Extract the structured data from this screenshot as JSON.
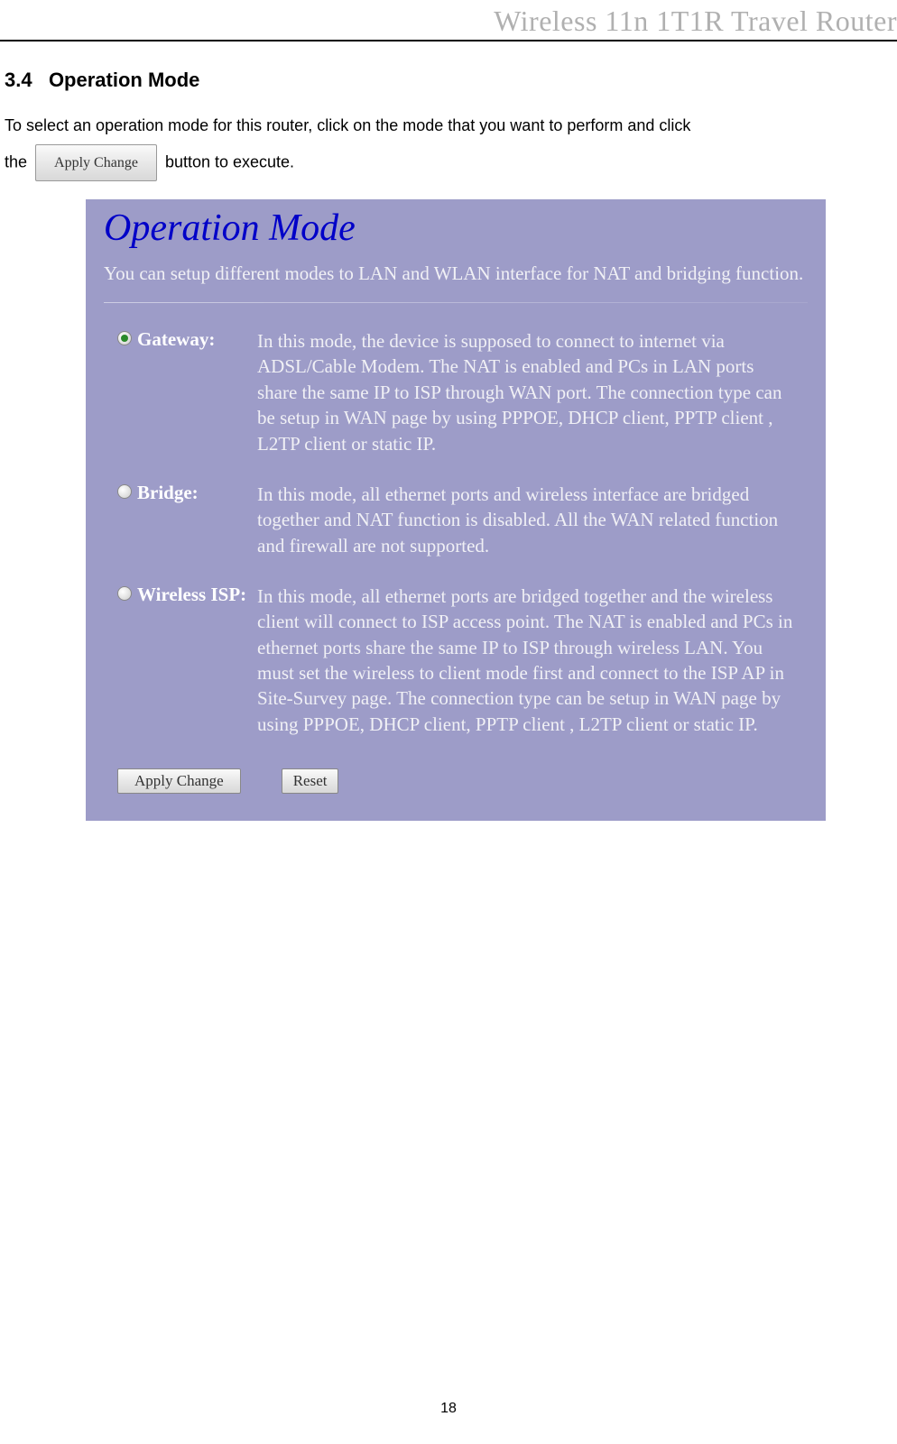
{
  "header": {
    "title": "Wireless 11n 1T1R Travel Router"
  },
  "section": {
    "number": "3.4",
    "title": "Operation Mode"
  },
  "intro": {
    "part1": "To select an operation mode for this router, click on the mode that you want to perform and click",
    "part2_prefix": "the",
    "inline_button": "Apply Change",
    "part2_suffix": "button to execute."
  },
  "panel": {
    "title": "Operation Mode",
    "description": "You can setup different modes to LAN and WLAN interface for NAT and bridging function.",
    "modes": [
      {
        "label": "Gateway:",
        "checked": true,
        "desc": "In this mode, the device is supposed to connect to internet via ADSL/Cable Modem. The NAT is enabled and PCs in LAN ports share the same IP to ISP through WAN port. The connection type can be setup in WAN page by using PPPOE, DHCP client, PPTP client , L2TP client or static IP."
      },
      {
        "label": "Bridge:",
        "checked": false,
        "desc": "In this mode, all ethernet ports and wireless interface are bridged together and NAT function is disabled. All the WAN related function and firewall are not supported."
      },
      {
        "label": "Wireless ISP:",
        "checked": false,
        "desc": "In this mode, all ethernet ports are bridged together and the wireless client will connect to ISP access point. The NAT is enabled and PCs in ethernet ports share the same IP to ISP through wireless LAN. You must set the wireless to client mode first and connect to the ISP AP in Site-Survey page. The connection type can be setup in WAN page by using PPPOE, DHCP client, PPTP client , L2TP client or static IP."
      }
    ],
    "buttons": {
      "apply": "Apply Change",
      "reset": "Reset"
    }
  },
  "page_number": "18"
}
